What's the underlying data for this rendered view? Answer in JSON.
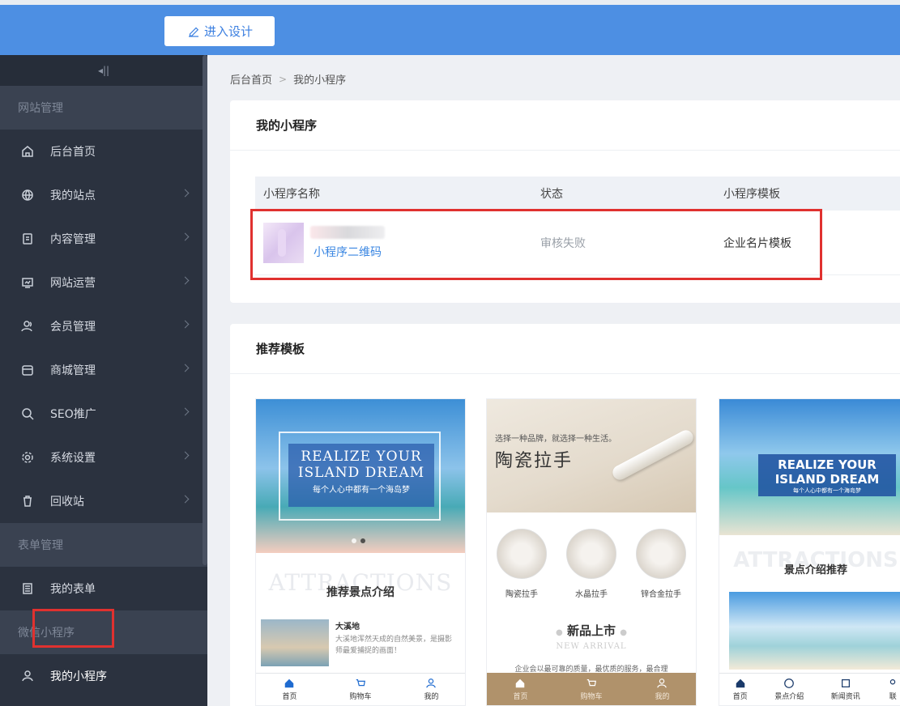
{
  "topbar": {
    "design_label": "进入设计"
  },
  "sidebar": {
    "collapse_label": "◂||",
    "groups": [
      {
        "label": "网站管理"
      },
      {
        "label": "表单管理"
      },
      {
        "label": "微信小程序"
      }
    ],
    "items": [
      {
        "label": "后台首页",
        "icon": "home-icon"
      },
      {
        "label": "我的站点",
        "icon": "globe-icon"
      },
      {
        "label": "内容管理",
        "icon": "document-icon"
      },
      {
        "label": "网站运营",
        "icon": "monitor-icon"
      },
      {
        "label": "会员管理",
        "icon": "user-group-icon"
      },
      {
        "label": "商城管理",
        "icon": "shop-icon"
      },
      {
        "label": "SEO推广",
        "icon": "search-icon"
      },
      {
        "label": "系统设置",
        "icon": "gear-icon"
      },
      {
        "label": "回收站",
        "icon": "trash-icon"
      },
      {
        "label": "我的表单",
        "icon": "form-icon"
      },
      {
        "label": "我的小程序",
        "icon": "user-icon"
      }
    ]
  },
  "breadcrumb": {
    "home": "后台首页",
    "sep": ">",
    "current": "我的小程序"
  },
  "mini": {
    "title": "我的小程序",
    "columns": [
      "小程序名称",
      "状态",
      "小程序模板"
    ],
    "row": {
      "qr_link": "小程序二维码",
      "status": "审核失败",
      "template": "企业名片模板"
    }
  },
  "recommend": {
    "title": "推荐模板",
    "t1": {
      "line1": "REALIZE YOUR",
      "line2": "ISLAND DREAM",
      "line3": "每个人心中都有一个海岛梦",
      "bg_word": "ATTRACTIONS",
      "heading": "推荐景点介绍",
      "spot_name": "大溪地",
      "spot_desc": "大溪地浑然天成的自然美景，是摄影师最爱捕捉的画面！",
      "tabs": [
        "首页",
        "购物车",
        "我的"
      ]
    },
    "t2": {
      "tagline": "选择一种品牌，就选择一种生活。",
      "headline": "陶瓷拉手",
      "products": [
        "陶瓷拉手",
        "水晶拉手",
        "锌合金拉手"
      ],
      "new_title": "新品上市",
      "new_sub": "NEW ARRIVAL",
      "new_text": "企业会以最可靠的质量，最优质的服务，最合理",
      "tabs": [
        "首页",
        "购物车",
        "我的"
      ]
    },
    "t3": {
      "line1": "REALIZE YOUR",
      "line2": "ISLAND DREAM",
      "line3": "每个人心中都有一个海岛梦",
      "bg_word": "ATTRACTIONS",
      "heading": "景点介绍推荐",
      "tabs": [
        "首页",
        "景点介绍",
        "新闻资讯",
        "联"
      ]
    }
  },
  "colors": {
    "accent": "#4d8fe3",
    "sidebar": "#2b323f",
    "highlight_box": "#e0312f",
    "link": "#3a86e2"
  }
}
